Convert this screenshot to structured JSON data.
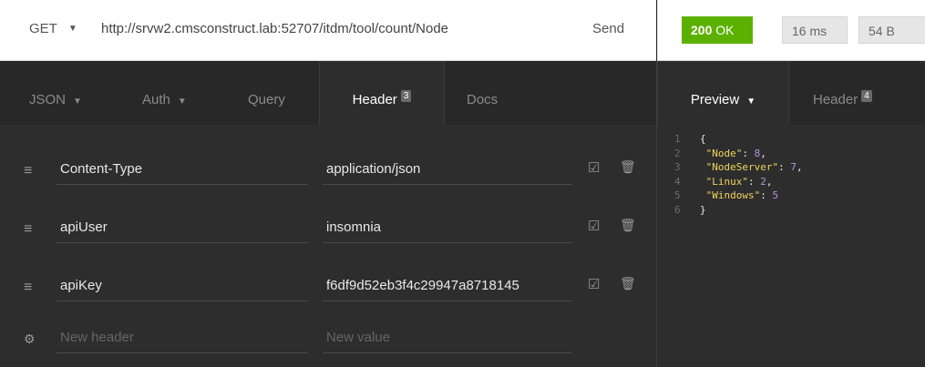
{
  "request": {
    "method": "GET",
    "url": "http://srvw2.cmsconstruct.lab:52707/itdm/tool/count/Node",
    "send_label": "Send"
  },
  "response": {
    "status_code": "200",
    "status_text": "OK",
    "time": "16 ms",
    "size": "54 B"
  },
  "request_tabs": {
    "json": "JSON",
    "auth": "Auth",
    "query": "Query",
    "header": "Header",
    "header_count": "3",
    "docs": "Docs"
  },
  "response_tabs": {
    "preview": "Preview",
    "header": "Header",
    "header_count": "4"
  },
  "headers": [
    {
      "name": "Content-Type",
      "value": "application/json"
    },
    {
      "name": "apiUser",
      "value": "insomnia"
    },
    {
      "name": "apiKey",
      "value": "f6df9d52eb3f4c29947a8718145"
    }
  ],
  "new_header": {
    "name_placeholder": "New header",
    "value_placeholder": "New value"
  },
  "preview_lines": [
    {
      "n": "1",
      "text": "{"
    },
    {
      "n": "2",
      "key": "\"Node\"",
      "val": "8",
      "sep": ","
    },
    {
      "n": "3",
      "key": "\"NodeServer\"",
      "val": "7",
      "sep": ","
    },
    {
      "n": "4",
      "key": "\"Linux\"",
      "val": "2",
      "sep": ","
    },
    {
      "n": "5",
      "key": "\"Windows\"",
      "val": "5",
      "sep": ""
    },
    {
      "n": "6",
      "text": "}"
    }
  ],
  "colors": {
    "status_ok": "#5cb100",
    "json_key": "#f0d35e",
    "json_number": "#b68fe0"
  }
}
